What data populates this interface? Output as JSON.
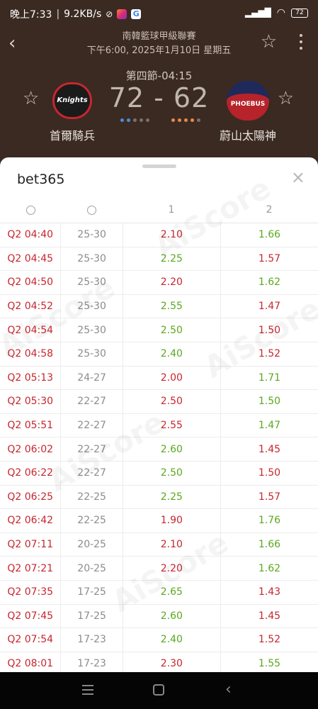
{
  "status_bar": {
    "time": "晚上7:33",
    "speed": "9.2KB/s",
    "battery": "72"
  },
  "match": {
    "league": "南韓籃球甲級聯賽",
    "datetime": "下午6:00, 2025年1月10日 星期五",
    "period": "第四節-04:15",
    "score": "72 - 62",
    "home_team": "首爾騎兵",
    "away_team": "蔚山太陽神",
    "home_logo_text": "Knights",
    "away_logo_text": "PHOEBUS"
  },
  "odds_panel": {
    "provider": "bet365",
    "close_label": "×",
    "columns": [
      "",
      "",
      "1",
      "2"
    ],
    "rows": [
      {
        "time": "Q2 04:40",
        "score": "25-30",
        "odd1": "2.10",
        "odd2": "1.66",
        "c1": "red",
        "c2": "green"
      },
      {
        "time": "Q2 04:45",
        "score": "25-30",
        "odd1": "2.25",
        "odd2": "1.57",
        "c1": "green",
        "c2": "red"
      },
      {
        "time": "Q2 04:50",
        "score": "25-30",
        "odd1": "2.20",
        "odd2": "1.62",
        "c1": "red",
        "c2": "green"
      },
      {
        "time": "Q2 04:52",
        "score": "25-30",
        "odd1": "2.55",
        "odd2": "1.47",
        "c1": "green",
        "c2": "red"
      },
      {
        "time": "Q2 04:54",
        "score": "25-30",
        "odd1": "2.50",
        "odd2": "1.50",
        "c1": "green",
        "c2": "red"
      },
      {
        "time": "Q2 04:58",
        "score": "25-30",
        "odd1": "2.40",
        "odd2": "1.52",
        "c1": "green",
        "c2": "red"
      },
      {
        "time": "Q2 05:13",
        "score": "24-27",
        "odd1": "2.00",
        "odd2": "1.71",
        "c1": "red",
        "c2": "green"
      },
      {
        "time": "Q2 05:30",
        "score": "22-27",
        "odd1": "2.50",
        "odd2": "1.50",
        "c1": "red",
        "c2": "green"
      },
      {
        "time": "Q2 05:51",
        "score": "22-27",
        "odd1": "2.55",
        "odd2": "1.47",
        "c1": "red",
        "c2": "green"
      },
      {
        "time": "Q2 06:02",
        "score": "22-27",
        "odd1": "2.60",
        "odd2": "1.45",
        "c1": "green",
        "c2": "red"
      },
      {
        "time": "Q2 06:22",
        "score": "22-27",
        "odd1": "2.50",
        "odd2": "1.50",
        "c1": "green",
        "c2": "red"
      },
      {
        "time": "Q2 06:25",
        "score": "22-25",
        "odd1": "2.25",
        "odd2": "1.57",
        "c1": "green",
        "c2": "red"
      },
      {
        "time": "Q2 06:42",
        "score": "22-25",
        "odd1": "1.90",
        "odd2": "1.76",
        "c1": "red",
        "c2": "green"
      },
      {
        "time": "Q2 07:11",
        "score": "20-25",
        "odd1": "2.10",
        "odd2": "1.66",
        "c1": "red",
        "c2": "green"
      },
      {
        "time": "Q2 07:21",
        "score": "20-25",
        "odd1": "2.20",
        "odd2": "1.62",
        "c1": "red",
        "c2": "green"
      },
      {
        "time": "Q2 07:35",
        "score": "17-25",
        "odd1": "2.65",
        "odd2": "1.43",
        "c1": "green",
        "c2": "red"
      },
      {
        "time": "Q2 07:45",
        "score": "17-25",
        "odd1": "2.60",
        "odd2": "1.45",
        "c1": "green",
        "c2": "red"
      },
      {
        "time": "Q2 07:54",
        "score": "17-23",
        "odd1": "2.40",
        "odd2": "1.52",
        "c1": "green",
        "c2": "red"
      },
      {
        "time": "Q2 08:01",
        "score": "17-23",
        "odd1": "2.30",
        "odd2": "1.55",
        "c1": "red",
        "c2": "green"
      }
    ]
  },
  "colors": {
    "header_bg": "#3a2a22",
    "odds_up": "#5aa81e",
    "odds_down": "#c6262e"
  },
  "watermark_text": "AiScore"
}
